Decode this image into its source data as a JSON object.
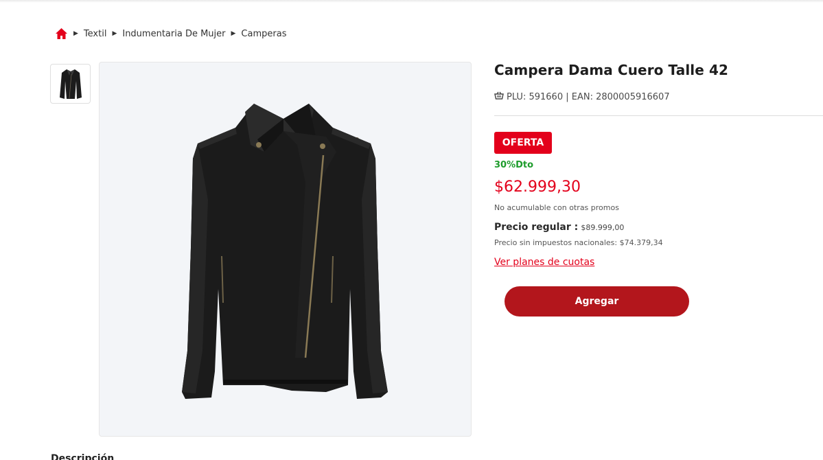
{
  "breadcrumb": {
    "home_icon": "home-icon",
    "items": [
      "Textil",
      "Indumentaria De Mujer",
      "Camperas"
    ]
  },
  "product": {
    "title": "Campera Dama Cuero Talle 42",
    "codes": "PLU: 591660 | EAN: 2800005916607",
    "badge": "OFERTA",
    "discount": "30%Dto",
    "price": "$62.999,30",
    "note": "No acumulable con otras promos",
    "regular_label": "Precio regular :",
    "regular_value": "$89.999,00",
    "tax_free": "Precio sin impuestos nacionales: $74.379,34",
    "installments_link": "Ver planes de cuotas",
    "add_button": "Agregar"
  },
  "description_title": "Descripción",
  "colors": {
    "accent_red": "#e3001b",
    "button_red": "#b3161c",
    "discount_green": "#1e9c2c"
  },
  "icons": [
    "home-icon",
    "basket-icon",
    "caret-right-icon"
  ]
}
